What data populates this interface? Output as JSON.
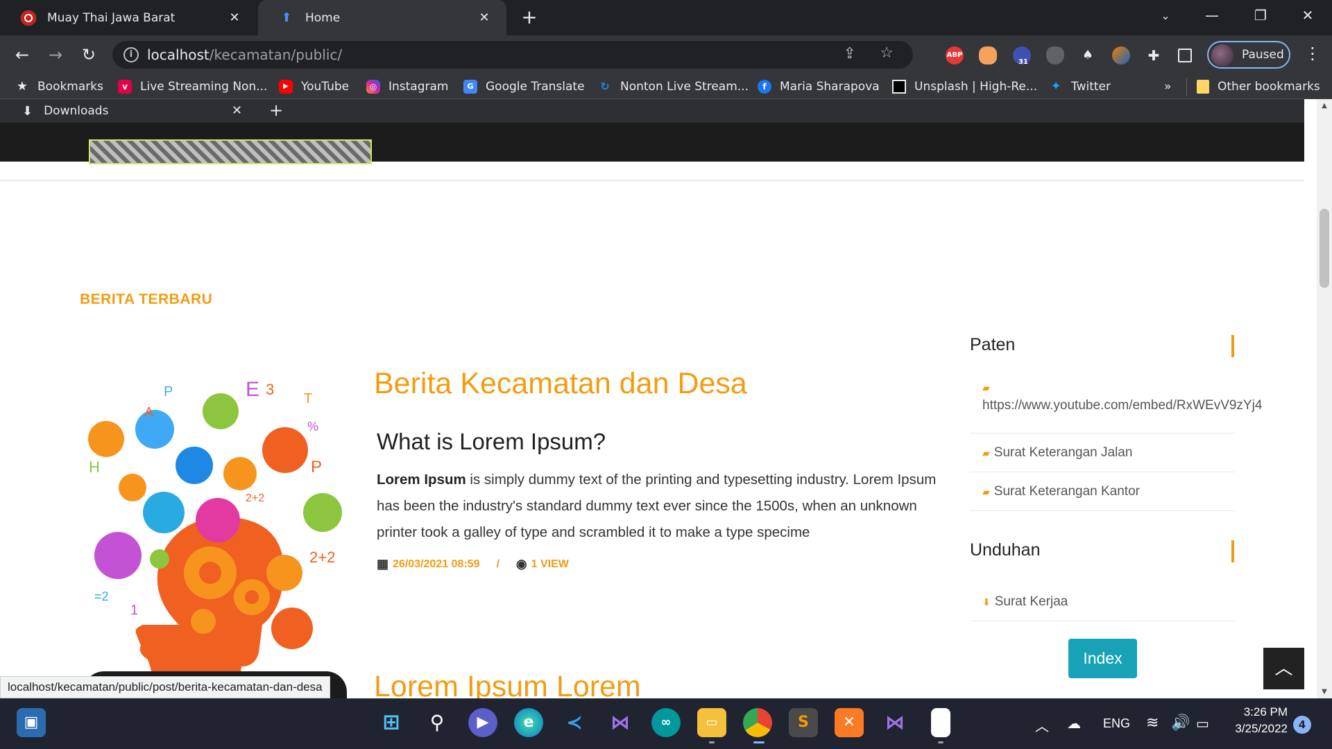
{
  "browser": {
    "tabs": [
      {
        "title": "Muay Thai Jawa Barat"
      },
      {
        "title": "Home"
      }
    ],
    "address": {
      "host": "localhost",
      "path": "/kecamatan/public/"
    },
    "profile_status": "Paused",
    "extensions": {
      "abp": "ABP",
      "calendar_badge": "31"
    },
    "bookmarks": [
      {
        "label": "Bookmarks",
        "icon": "star-icon"
      },
      {
        "label": "Live Streaming Non...",
        "icon": "vidio-icon",
        "color": "#e4004b"
      },
      {
        "label": "YouTube",
        "icon": "youtube-icon",
        "color": "#ff0000"
      },
      {
        "label": "Instagram",
        "icon": "instagram-icon",
        "color": "#d6249f"
      },
      {
        "label": "Google Translate",
        "icon": "google-translate-icon",
        "color": "#4285f4"
      },
      {
        "label": "Nonton Live Stream...",
        "icon": "stream-icon",
        "color": "#1e88e5"
      },
      {
        "label": "Maria Sharapova",
        "icon": "facebook-icon",
        "color": "#1877f2"
      },
      {
        "label": "Unsplash | High-Re...",
        "icon": "unsplash-icon",
        "color": "#000000"
      },
      {
        "label": "Twitter",
        "icon": "twitter-icon",
        "color": "#1da1f2"
      }
    ],
    "bookmarks_overflow": "»",
    "other_bookmarks": "Other bookmarks"
  },
  "downloads_bar": {
    "label": "Downloads"
  },
  "page": {
    "section_label": "BERITA TERBARU",
    "post": {
      "title": "Berita Kecamatan dan Desa",
      "subtitle": "What is Lorem Ipsum?",
      "body_bold": "Lorem Ipsum",
      "body_rest": " is simply dummy text of the printing and typesetting industry. Lorem Ipsum has been the industry's standard dummy text ever since the 1500s, when an unknown printer took a galley of type and scrambled it to make a type specime",
      "date": "26/03/2021 08:59",
      "separator": "/",
      "views": "1 VIEW"
    },
    "post2": {
      "title": "Lorem Ipsum Lorem"
    },
    "sidebar": {
      "sections": [
        {
          "title": "Paten",
          "items": [
            "https://www.youtube.com/embed/RxWEvV9zYj4",
            "Surat Keterangan Jalan",
            "Surat Keterangan Kantor"
          ]
        },
        {
          "title": "Unduhan",
          "items": [
            "Surat Kerjaa"
          ]
        }
      ],
      "index_button": "Index"
    },
    "status_link": "localhost/kecamatan/public/post/berita-kecamatan-dan-desa"
  },
  "taskbar": {
    "language": "ENG",
    "time": "3:26 PM",
    "date": "3/25/2022",
    "notifications": "4"
  },
  "colors": {
    "accent": "#f39c12",
    "button": "#17a2b8",
    "chrome_dark": "#202124",
    "chrome": "#35363a"
  }
}
